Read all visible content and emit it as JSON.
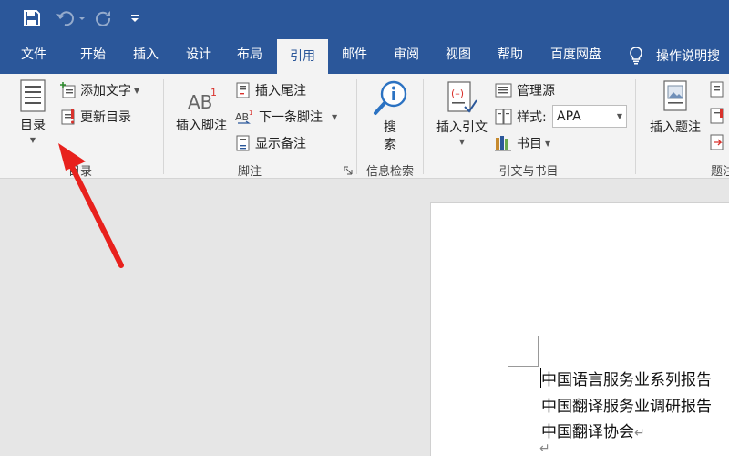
{
  "quick_access": {
    "save_icon": "save-icon",
    "undo_icon": "undo-icon",
    "redo_icon": "redo-icon",
    "customize_icon": "customize-qat-icon"
  },
  "tabs": [
    {
      "label": "文件"
    },
    {
      "label": "开始"
    },
    {
      "label": "插入"
    },
    {
      "label": "设计"
    },
    {
      "label": "布局"
    },
    {
      "label": "引用",
      "active": true
    },
    {
      "label": "邮件"
    },
    {
      "label": "审阅"
    },
    {
      "label": "视图"
    },
    {
      "label": "帮助"
    },
    {
      "label": "百度网盘"
    }
  ],
  "tell_me": "操作说明搜",
  "ribbon": {
    "toc_group": {
      "toc_button": "目录",
      "add_text": "添加文字",
      "update_toc": "更新目录",
      "label": "目录"
    },
    "footnote_group": {
      "insert_footnote": "插入脚注",
      "insert_endnote": "插入尾注",
      "next_footnote": "下一条脚注",
      "show_notes": "显示备注",
      "label": "脚注"
    },
    "research_group": {
      "search": "搜\n索",
      "label": "信息检索"
    },
    "citation_group": {
      "insert_citation": "插入引文",
      "manage_sources": "管理源",
      "style_label": "样式:",
      "style_value": "APA",
      "bibliography": "书目",
      "label": "引文与书目"
    },
    "caption_group": {
      "insert_caption": "插入题注",
      "label": "题注"
    }
  },
  "document": {
    "lines": [
      "中国语言服务业系列报告",
      "中国翻译服务业调研报告",
      "中国翻译协会"
    ],
    "para_mark": "↵"
  },
  "colors": {
    "accent": "#2b579a",
    "ribbon_bg": "#f3f3f3",
    "arrow": "#e8211d"
  }
}
